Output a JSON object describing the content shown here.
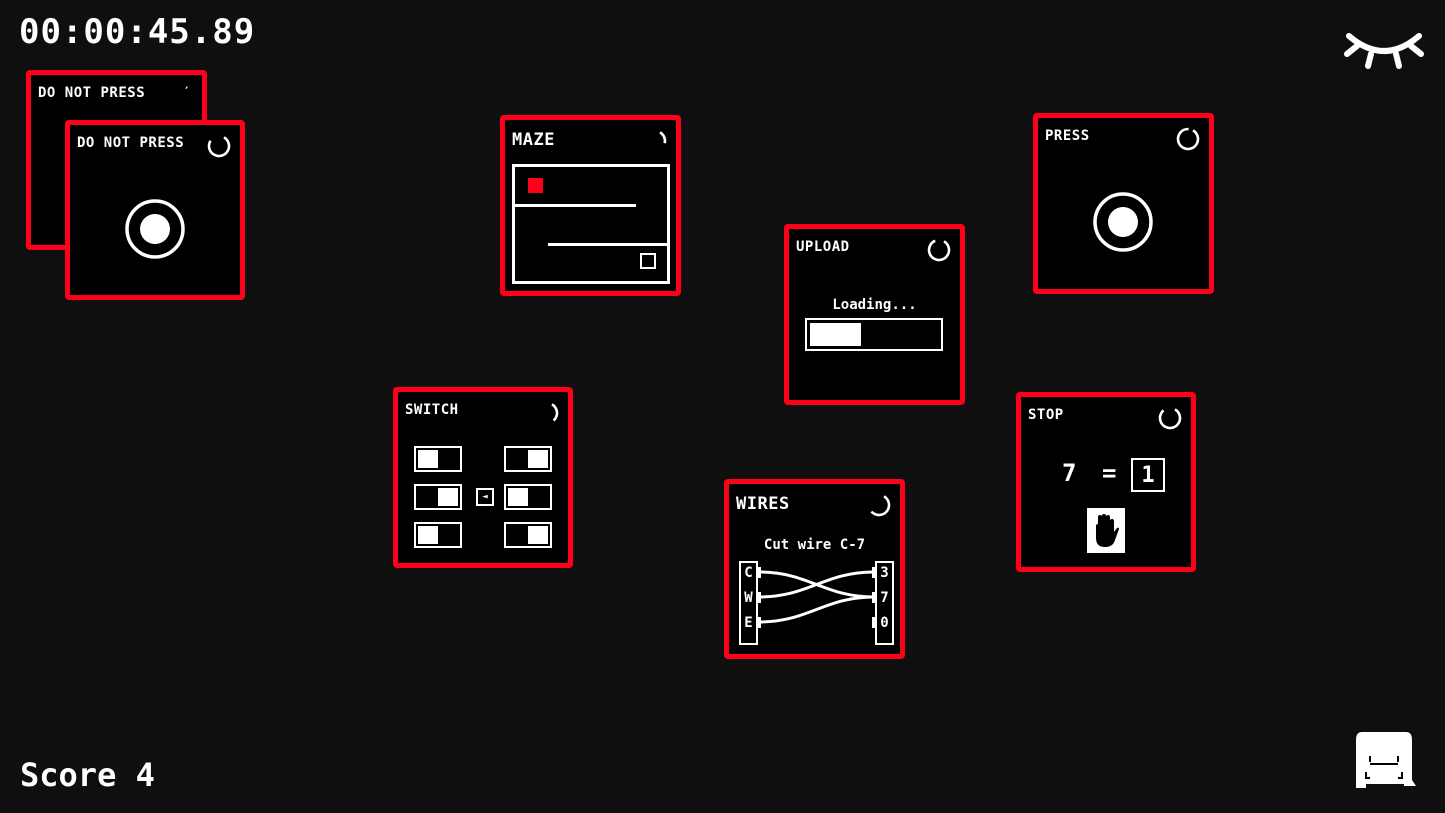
{
  "hud": {
    "timer": "00:00:45.89",
    "score_label": "Score 4",
    "eye_icon": "eye-closed-icon",
    "ghost_icon": "ghost-icon"
  },
  "colors": {
    "accent": "#ff0018",
    "background": "#0f0f0f",
    "panel": "#000000",
    "foreground": "#ffffff"
  },
  "panels": {
    "do_not_press_back": {
      "title": "DO NOT PRESS",
      "timer_remaining": 0.02
    },
    "do_not_press_front": {
      "title": "DO NOT PRESS",
      "timer_remaining": 0.75
    },
    "maze": {
      "title": "MAZE",
      "timer_remaining": 0.2
    },
    "upload": {
      "title": "UPLOAD",
      "loading_text": "Loading...",
      "progress_percent": 40,
      "timer_remaining": 0.85
    },
    "press": {
      "title": "PRESS",
      "timer_remaining": 0.92
    },
    "switch": {
      "title": "SWITCH",
      "timer_remaining": 0.3,
      "arrow": "◄",
      "switches": [
        {
          "position": "left"
        },
        {
          "position": "right"
        },
        {
          "position": "right"
        },
        {
          "position": "left"
        },
        {
          "position": "left"
        },
        {
          "position": "right"
        }
      ]
    },
    "wires": {
      "title": "WIRES",
      "instruction": "Cut wire C-7",
      "timer_remaining": 0.55,
      "left_labels": [
        "C",
        "W",
        "E"
      ],
      "right_labels": [
        "3",
        "7",
        "0"
      ],
      "connections": [
        [
          "C",
          "7"
        ],
        [
          "W",
          "3"
        ],
        [
          "E",
          "7"
        ]
      ]
    },
    "stop": {
      "title": "STOP",
      "timer_remaining": 0.8,
      "left_value": "7",
      "equals": "=",
      "right_value": "1",
      "button_icon": "hand-stop-icon"
    }
  }
}
